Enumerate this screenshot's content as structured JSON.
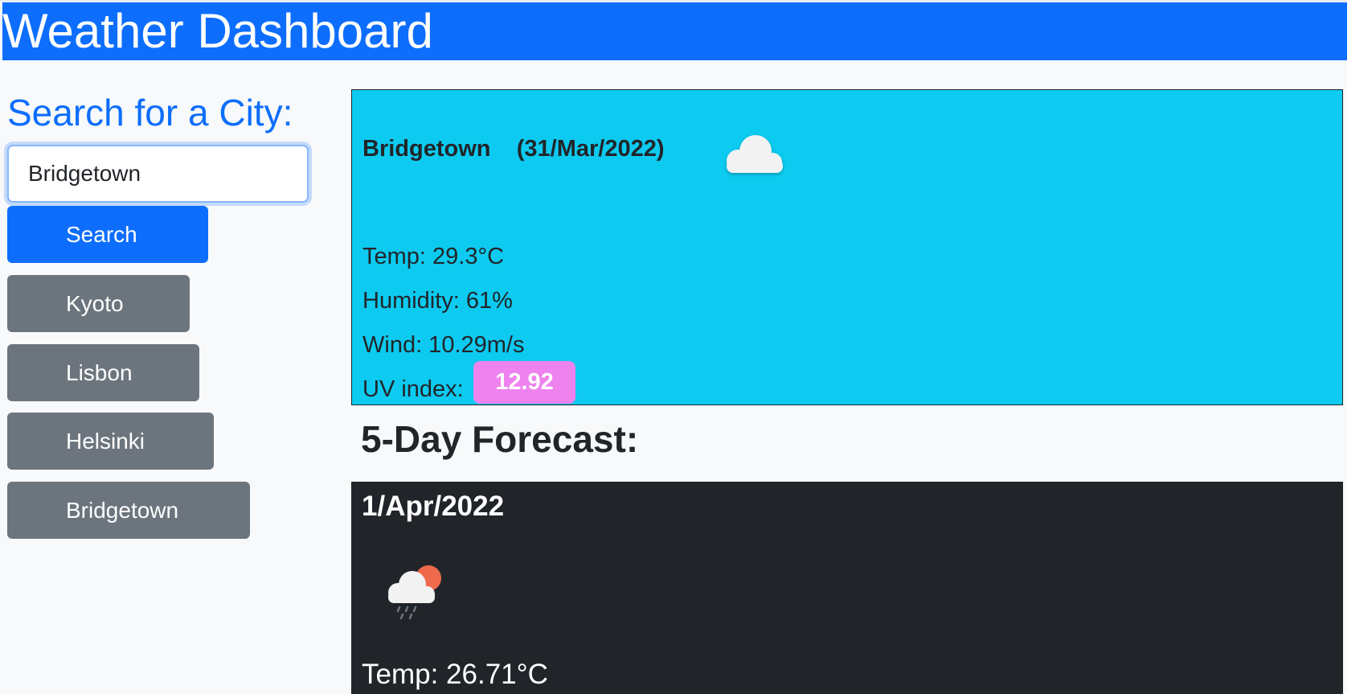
{
  "header": {
    "title": "Weather Dashboard"
  },
  "sidebar": {
    "search_title": "Search for a City:",
    "search_value": "Bridgetown",
    "search_button": "Search",
    "history": [
      "Kyoto",
      "Lisbon",
      "Helsinki",
      "Bridgetown"
    ]
  },
  "current": {
    "city": "Bridgetown",
    "date": "(31/Mar/2022)",
    "icon": "cloud-icon",
    "temp": "Temp: 29.3°C",
    "humidity": "Humidity: 61%",
    "wind": "Wind: 10.29m/s",
    "uv_label": "UV index:",
    "uv_value": "12.92",
    "uv_color": "#ee82ee",
    "background": "#0dcaf0"
  },
  "forecast": {
    "title": "5-Day Forecast:",
    "days": [
      {
        "date": "1/Apr/2022",
        "icon": "rain-sun-cloud-icon",
        "temp": "Temp: 26.71°C"
      }
    ]
  },
  "colors": {
    "primary": "#0d6efd",
    "secondary": "#6c757d",
    "dark": "#212529"
  }
}
